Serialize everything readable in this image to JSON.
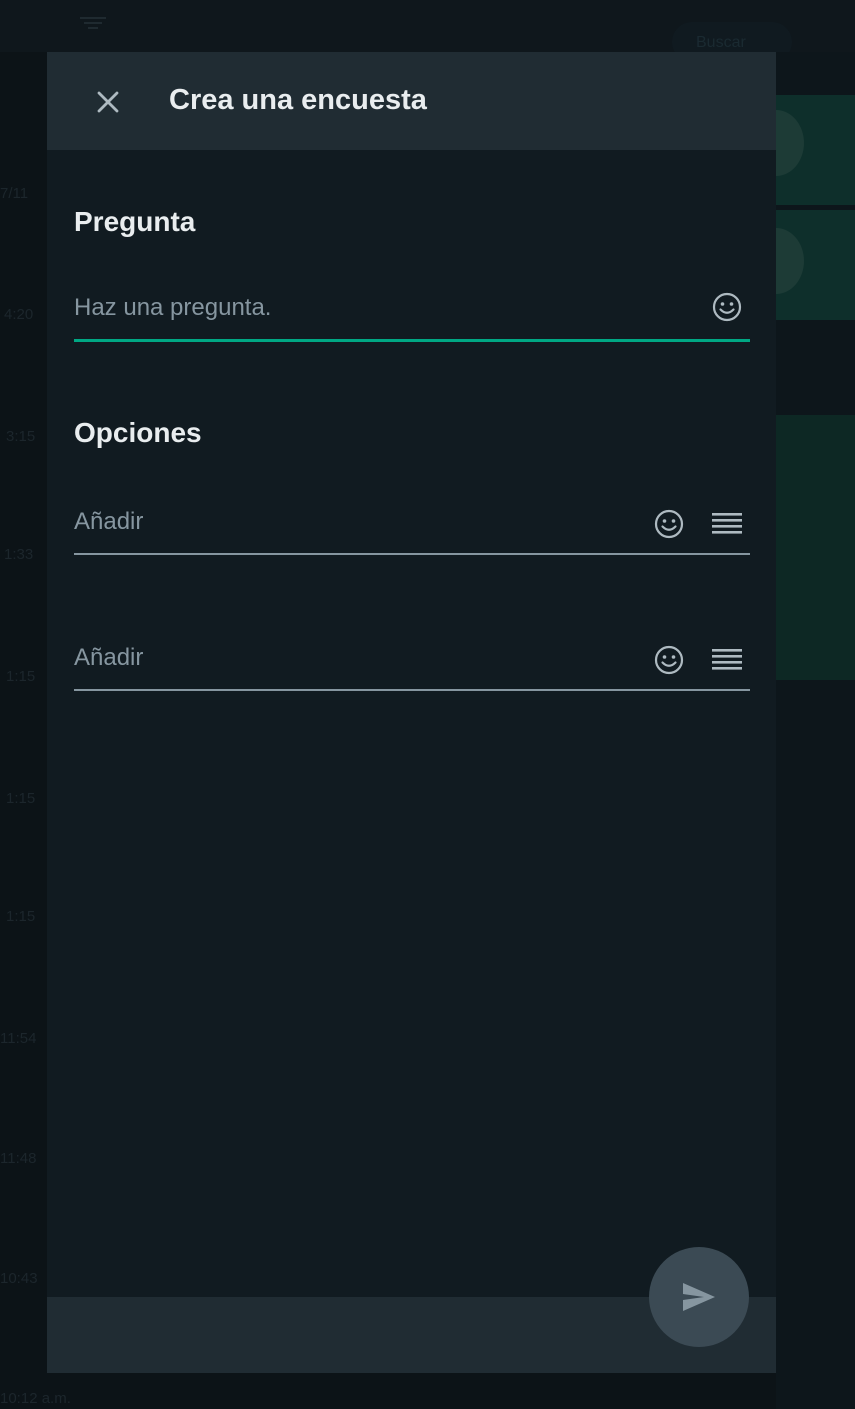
{
  "background": {
    "search_pill_label": "Buscar",
    "times": [
      "7/11",
      "4:20",
      "3:15",
      "1:33",
      "1:15",
      "1:15",
      "1:15",
      "11:54",
      "11:48",
      "10:43",
      "10:12 a.m."
    ]
  },
  "dialog": {
    "title": "Crea una encuesta",
    "question": {
      "heading": "Pregunta",
      "placeholder": "Haz una pregunta.",
      "value": ""
    },
    "options": {
      "heading": "Opciones",
      "items": [
        {
          "placeholder": "Añadir",
          "value": ""
        },
        {
          "placeholder": "Añadir",
          "value": ""
        }
      ]
    }
  },
  "icons": {
    "close": "close-icon",
    "emoji": "emoji-icon",
    "drag": "drag-handle-icon",
    "send": "send-icon"
  },
  "colors": {
    "accent": "#00a884",
    "dialog_bg": "#111b21",
    "header_bg": "#202c33",
    "text_primary": "#e9edef",
    "text_secondary": "#8696a0",
    "send_button": "#3b4a54"
  }
}
